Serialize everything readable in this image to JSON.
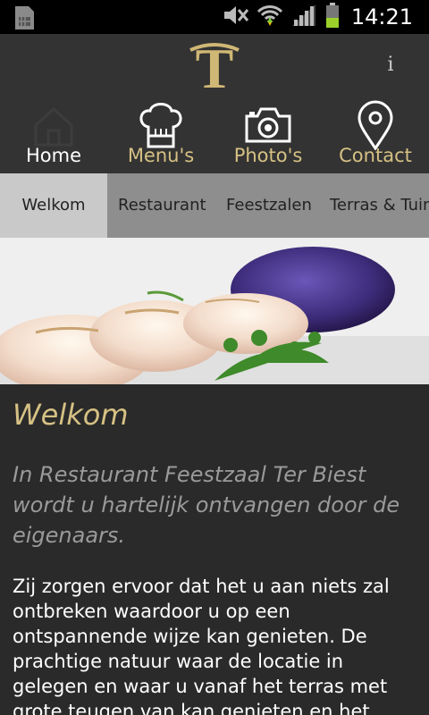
{
  "status_bar": {
    "time": "14:21",
    "icons": [
      "sim-card-icon",
      "mute-icon",
      "wifi-icon",
      "signal-icon",
      "battery-icon"
    ]
  },
  "header": {
    "logo_text": "T",
    "info_label": "i"
  },
  "nav": {
    "items": [
      {
        "label": "Home",
        "icon": "home-icon",
        "active": true
      },
      {
        "label": "Menu's",
        "icon": "chef-hat-icon",
        "active": false
      },
      {
        "label": "Photo's",
        "icon": "camera-icon",
        "active": false
      },
      {
        "label": "Contact",
        "icon": "location-pin-icon",
        "active": false
      }
    ]
  },
  "subtabs": {
    "items": [
      {
        "label": "Welkom",
        "active": true
      },
      {
        "label": "Restaurant",
        "active": false
      },
      {
        "label": "Feestzalen",
        "active": false
      },
      {
        "label": "Terras & Tuin",
        "active": false
      }
    ]
  },
  "content": {
    "heading": "Welkom",
    "intro": "In Restaurant Feestzaal Ter Biest wordt u hartelijk ontvangen door de eigenaars.",
    "body": "Zij zorgen ervoor dat het u aan niets zal ontbreken waardoor u op een ontspannende wijze kan genieten. De prachtige natuur waar de locatie in gelegen en waar u vanaf het terras met grote teugen van kan genieten en het"
  },
  "colors": {
    "accent_gold": "#d6c184",
    "header_bg": "#333333",
    "content_bg": "#2a2a2a",
    "subtab_bg": "#8e8e8e",
    "subtab_active_bg": "#c9c9c9",
    "intro_text": "#9a9a9a"
  }
}
